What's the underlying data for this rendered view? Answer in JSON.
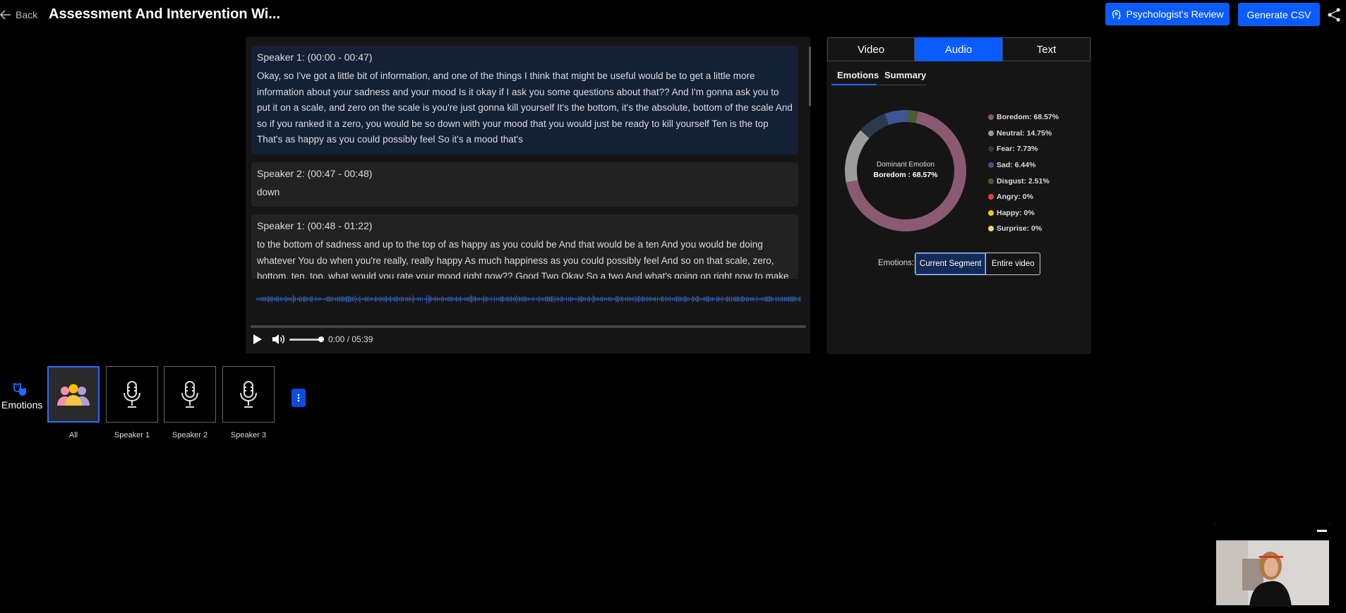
{
  "header": {
    "back_label": "Back",
    "title": "Assessment And Intervention Wi...",
    "review_button": "Psychologist's Review",
    "csv_button": "Generate CSV"
  },
  "transcript": {
    "segments": [
      {
        "heading": "Speaker 1: (00:00 - 00:47)",
        "text": "Okay, so I've got a little bit of information, and one of the things I think that might be useful would be to get a little more information about your sadness and your mood Is it okay if I ask you some questions about that?? And I'm gonna ask you to put it on a scale, and zero on the scale is you're just gonna kill yourself It's the bottom, it's the absolute, bottom of the scale And so if you ranked it a zero, you would be so down with your mood that you would just be ready to kill yourself Ten is the top That's as happy as you could possibly feel So it's a mood that's"
      },
      {
        "heading": "Speaker 2: (00:47 - 00:48)",
        "text": "down"
      },
      {
        "heading": "Speaker 1: (00:48 - 01:22)",
        "text": "to the bottom of sadness and up to the top of as happy as you could be And that would be a ten And you would be doing whatever You do when you're really, really happy As much happiness as you could possibly feel And so on that scale, zero, bottom, ten, top, what would you rate your mood right now?? Good Two Okay So a two And what's going on right now to make it a two??"
      }
    ]
  },
  "player": {
    "time": "0:00 / 05:39",
    "progress": 0,
    "volume": 0.85
  },
  "right_panel": {
    "tabs": [
      "Video",
      "Audio",
      "Text"
    ],
    "active_tab": "Audio",
    "subtabs": [
      "Emotions",
      "Summary"
    ],
    "active_subtab": "Emotions",
    "donut_center_label": "Dominant Emotion",
    "donut_center_value": "Boredom : 68.57%",
    "emotions_label": "Emotions:",
    "segment_buttons": [
      "Current Segment",
      "Entire video"
    ],
    "active_segment_button": "Current Segment"
  },
  "chart_data": {
    "type": "pie",
    "categories": [
      "Boredom",
      "Neutral",
      "Fear",
      "Sad",
      "Disgust",
      "Angry",
      "Happy",
      "Surprise"
    ],
    "values": [
      68.57,
      14.75,
      7.73,
      6.44,
      2.51,
      0,
      0,
      0
    ],
    "legend_labels": [
      "Boredom: 68.57%",
      "Neutral: 14.75%",
      "Fear: 7.73%",
      "Sad: 6.44%",
      "Disgust: 2.51%",
      "Angry: 0%",
      "Happy: 0%",
      "Surprise: 0%"
    ],
    "colors": [
      "#8a5a72",
      "#9c9c9c",
      "#2c3a4e",
      "#3e5494",
      "#4b5e2a",
      "#e84040",
      "#f0c419",
      "#f5d76e"
    ],
    "legend_position": "right"
  },
  "speakers": {
    "section_label": "Emotions",
    "items": [
      "All",
      "Speaker 1",
      "Speaker 2",
      "Speaker 3"
    ],
    "active": "All"
  },
  "colors": {
    "accent": "#0a5cff",
    "background": "#000000"
  }
}
